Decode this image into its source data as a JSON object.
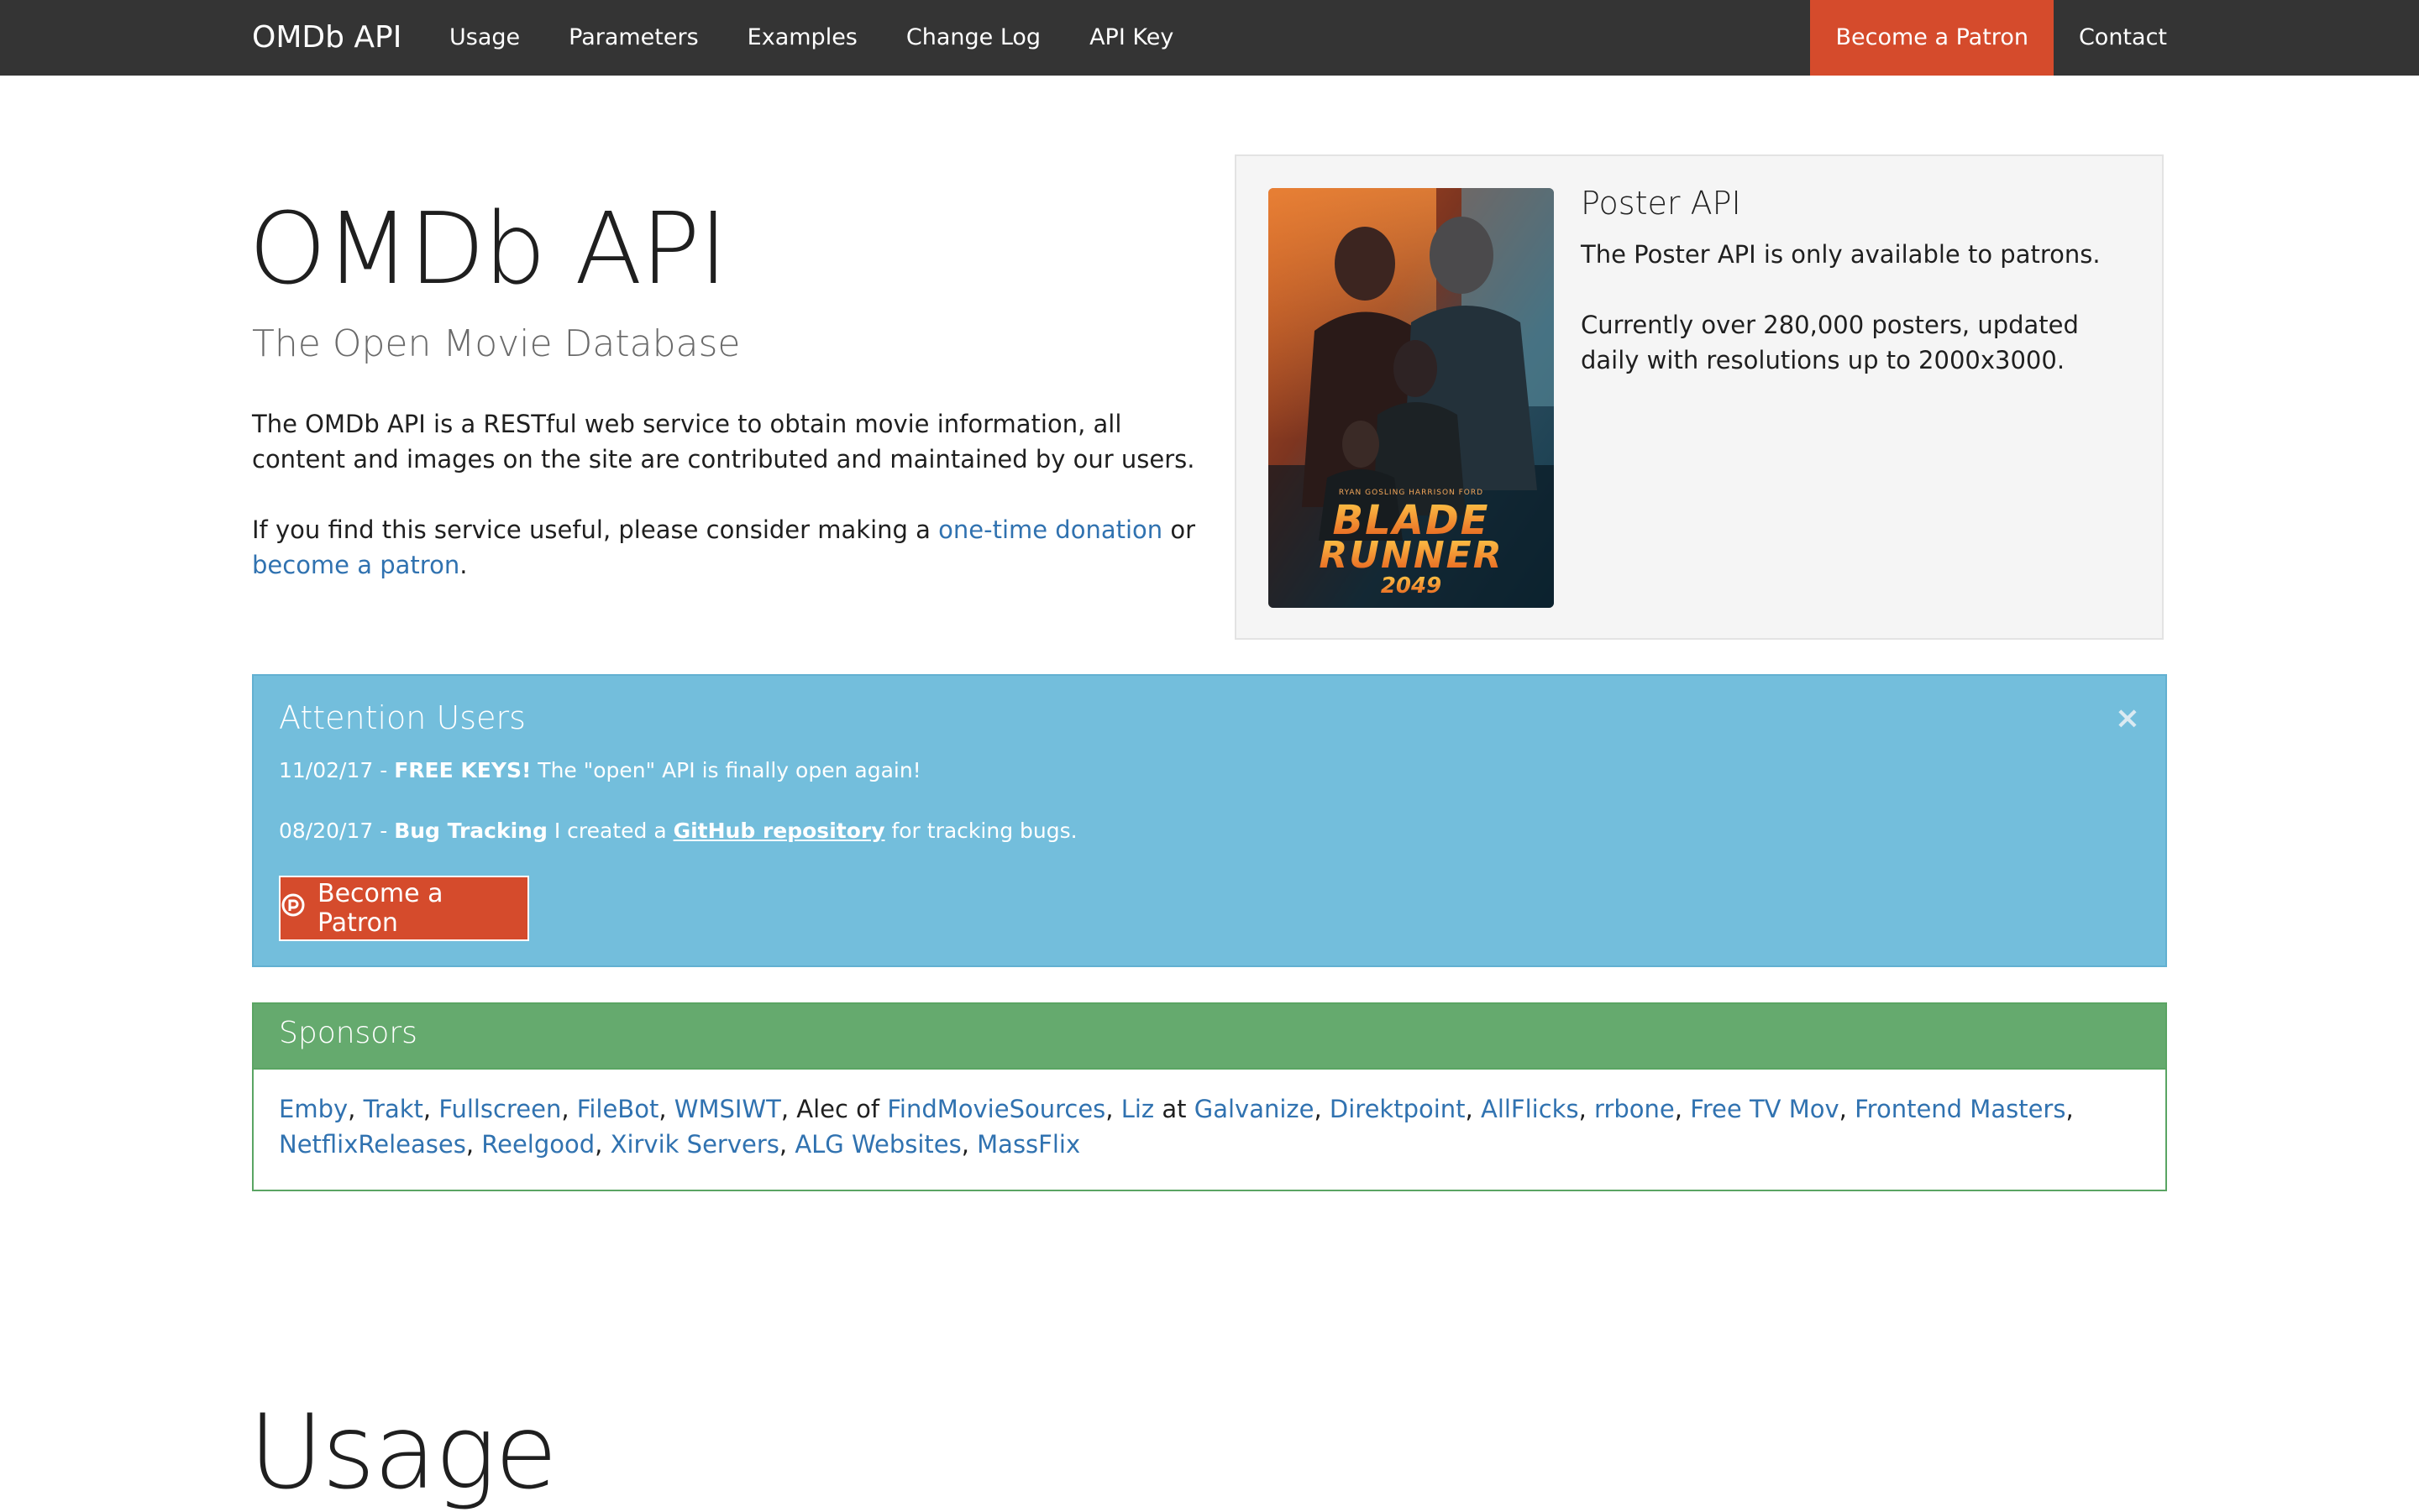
{
  "nav": {
    "brand": "OMDb API",
    "links": [
      "Usage",
      "Parameters",
      "Examples",
      "Change Log",
      "API Key"
    ],
    "patron": "Become a Patron",
    "contact": "Contact"
  },
  "hero": {
    "title": "OMDb API",
    "subtitle": "The Open Movie Database",
    "description": "The OMDb API is a RESTful web service to obtain movie information, all content and images on the site are contributed and maintained by our users.",
    "donate_prefix": "If you find this service useful, please consider making a",
    "donate_link": "one-time donation",
    "donate_mid": "or",
    "patron_link": "become a patron",
    "donate_suffix": "."
  },
  "poster_card": {
    "title": "Poster API",
    "line1": "The Poster API is only available to patrons.",
    "line2": "Currently over 280,000 posters, updated daily with resolutions up to 2000x3000.",
    "poster_top_credits": "RYAN GOSLING   HARRISON FORD",
    "poster_title_1": "BLADE",
    "poster_title_2": "RUNNER",
    "poster_title_3": "2049"
  },
  "alert": {
    "title": "Attention Users",
    "close": "×",
    "item1_date": "11/02/17 - ",
    "item1_bold": "FREE KEYS!",
    "item1_text": " The \"open\" API is finally open again!",
    "item2_date": "08/20/17 - ",
    "item2_bold": "Bug Tracking",
    "item2_pre": " I created a ",
    "item2_link": "GitHub repository",
    "item2_post": " for tracking bugs.",
    "button": "Become a Patron"
  },
  "sponsors": {
    "title": "Sponsors",
    "items": [
      {
        "t": "Emby",
        "link": true
      },
      {
        "t": ", ",
        "link": false
      },
      {
        "t": "Trakt",
        "link": true
      },
      {
        "t": ", ",
        "link": false
      },
      {
        "t": "Fullscreen",
        "link": true
      },
      {
        "t": ", ",
        "link": false
      },
      {
        "t": "FileBot",
        "link": true
      },
      {
        "t": ", ",
        "link": false
      },
      {
        "t": "WMSIWT",
        "link": true
      },
      {
        "t": ", Alec of ",
        "link": false
      },
      {
        "t": "FindMovieSources",
        "link": true
      },
      {
        "t": ", ",
        "link": false
      },
      {
        "t": "Liz",
        "link": true
      },
      {
        "t": " at ",
        "link": false
      },
      {
        "t": "Galvanize",
        "link": true
      },
      {
        "t": ", ",
        "link": false
      },
      {
        "t": "Direktpoint",
        "link": true
      },
      {
        "t": ", ",
        "link": false
      },
      {
        "t": "AllFlicks",
        "link": true
      },
      {
        "t": ", ",
        "link": false
      },
      {
        "t": "rrbone",
        "link": true
      },
      {
        "t": ", ",
        "link": false
      },
      {
        "t": "Free TV Mov",
        "link": true
      },
      {
        "t": ", ",
        "link": false
      },
      {
        "t": "Frontend Masters",
        "link": true
      },
      {
        "t": ", ",
        "link": false
      },
      {
        "t": "NetflixReleases",
        "link": true
      },
      {
        "t": ", ",
        "link": false
      },
      {
        "t": "Reelgood",
        "link": true
      },
      {
        "t": ", ",
        "link": false
      },
      {
        "t": "Xirvik Servers",
        "link": true
      },
      {
        "t": ", ",
        "link": false
      },
      {
        "t": "ALG Websites",
        "link": true
      },
      {
        "t": ", ",
        "link": false
      },
      {
        "t": "MassFlix",
        "link": true
      }
    ]
  },
  "usage": {
    "heading": "Usage"
  }
}
